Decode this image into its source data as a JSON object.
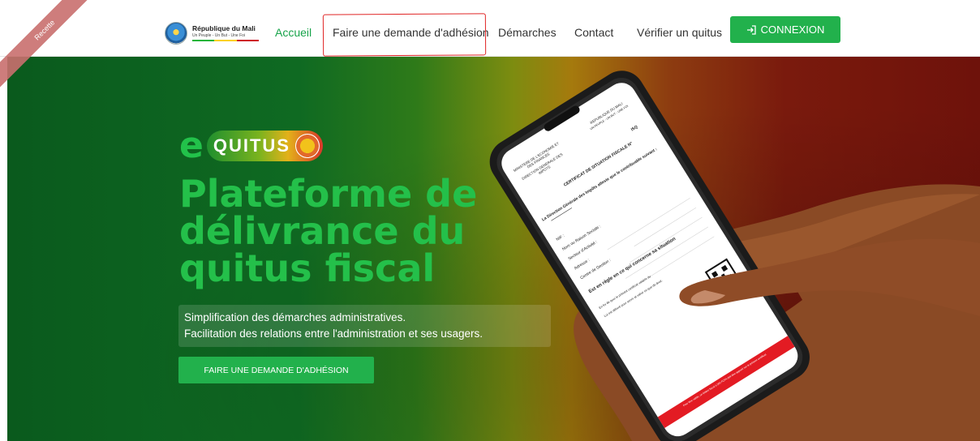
{
  "header": {
    "brand": {
      "title": "République du Mali",
      "motto": "Un Peuple - Un But - Une Foi"
    },
    "nav": [
      {
        "label": "Accueil",
        "active": true
      },
      {
        "label": "Faire une demande d'adhésion",
        "active": false
      },
      {
        "label": "Démarches",
        "active": false
      },
      {
        "label": "Contact",
        "active": false
      },
      {
        "label": "Vérifier un quitus",
        "active": false
      }
    ],
    "login": {
      "label": "CONNEXION",
      "icon": "login-icon"
    }
  },
  "ribbon": {
    "label": "Recette"
  },
  "hero": {
    "logo": {
      "prefix": "e",
      "word": "QUITUS"
    },
    "title": "Plateforme de délivrance du quitus fiscal",
    "description": [
      "Simplification des démarches administratives.",
      "Facilitation des relations entre l'administration et ses usagers."
    ],
    "cta": "FAIRE UNE DEMANDE D'ADHÉSION"
  },
  "phone_screen": {
    "ministry": "MINISTERE DE L'ECONOMIE ET DES FINANCES",
    "direction": "DIRECTION GENERALE DES IMPOTS",
    "republic": "REPUBLIQUE DU MALI",
    "motto": "UN PEUPLE - UN BUT - UNE FOI",
    "isq": "ISQ",
    "certificate_title": "CERTIFICAT DE SITUATION FISCALE N°",
    "attest": "La Direction Générale des Impôts atteste que le contribuable suivant :",
    "fields": [
      "NIF :",
      "Nom ou Raison Sociale :",
      "Secteur d'Activité :",
      "Adresse :",
      "Centre de Gestion :"
    ],
    "status": "Est en règle en ce qui concerne sa situation",
    "foot1": "En foi de quoi le présent certificat valable du",
    "foot2": "Lui est délivré pour servir et valoir ce que de droit.",
    "banner": "Pour être valide, un timbre fiscal à 500 FCFA doit être apposé sur le présent certificat."
  },
  "colors": {
    "accent_green": "#22b14c",
    "title_green": "#24c04a",
    "highlight_red": "#e02424",
    "flag": [
      "#14b53a",
      "#fcd116",
      "#ce1126"
    ]
  }
}
